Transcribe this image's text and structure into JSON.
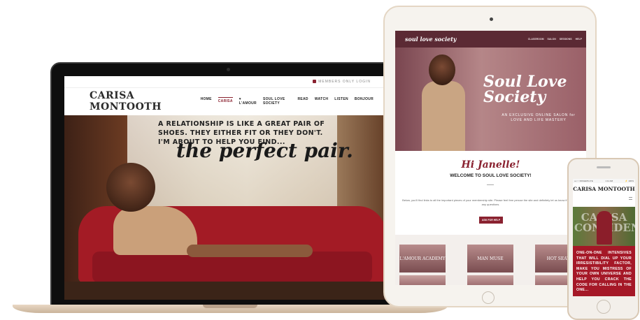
{
  "laptop": {
    "members_login": "MEMBERS ONLY LOGIN",
    "logo": "CARISA MONTOOTH",
    "nav": [
      "HOME",
      "CARISA",
      "♥ L'AMOUR",
      "SOUL LOVE SOCIETY",
      "READ",
      "WATCH",
      "LISTEN",
      "BONJOUR"
    ],
    "active_nav": "CARISA",
    "hero_quote": "A RELATIONSHIP IS LIKE A GREAT PAIR OF SHOES. THEY EITHER FIT OR THEY DON'T. I'M ABOUT TO HELP YOU FIND...",
    "hero_script": "the perfect pair."
  },
  "tablet": {
    "brand": "soul love society",
    "nav": [
      "CLASSROOM",
      "SALON",
      "SESSIONS",
      "HELP"
    ],
    "hero_title": "Soul Love Society",
    "hero_subtitle": "AN EXCLUSIVE ONLINE SALON for LOVE AND LIFE MASTERY",
    "greeting": "Hi Janelle!",
    "welcome": "WELCOME TO SOUL LOVE SOCIETY!",
    "body": "Below, you'll find links to all the important pieces of your membership site. Please feel free peruse the site and definitely let us know if you have any questions.",
    "button": "ASK FOR HELP",
    "cards": [
      "L'AMOUR ACADEMY",
      "MAN MUSE",
      "HOT SEAT"
    ]
  },
  "phone": {
    "status_left": "•••○○ ROGERS LTE",
    "status_time": "1:11 AM",
    "status_right": "⚡ 100%",
    "logo": "CARISA MONTOOTH",
    "hero_text": "CARISA CONFIDENTIAL",
    "red_text": "ONE-ON-ONE INTENSIVES THAT WILL DIAL UP YOUR IRRESISTIBILITY FACTOR, MAKE YOU MISTRESS OF YOUR OWN UNIVERSE AND HELP YOU CRACK THE CODE FOR CALLING IN THE ONE..."
  },
  "colors": {
    "accent": "#8a2230",
    "tablet_nav": "#5b2a34",
    "phone_red": "#a51827",
    "sofa": "#a31b25"
  }
}
